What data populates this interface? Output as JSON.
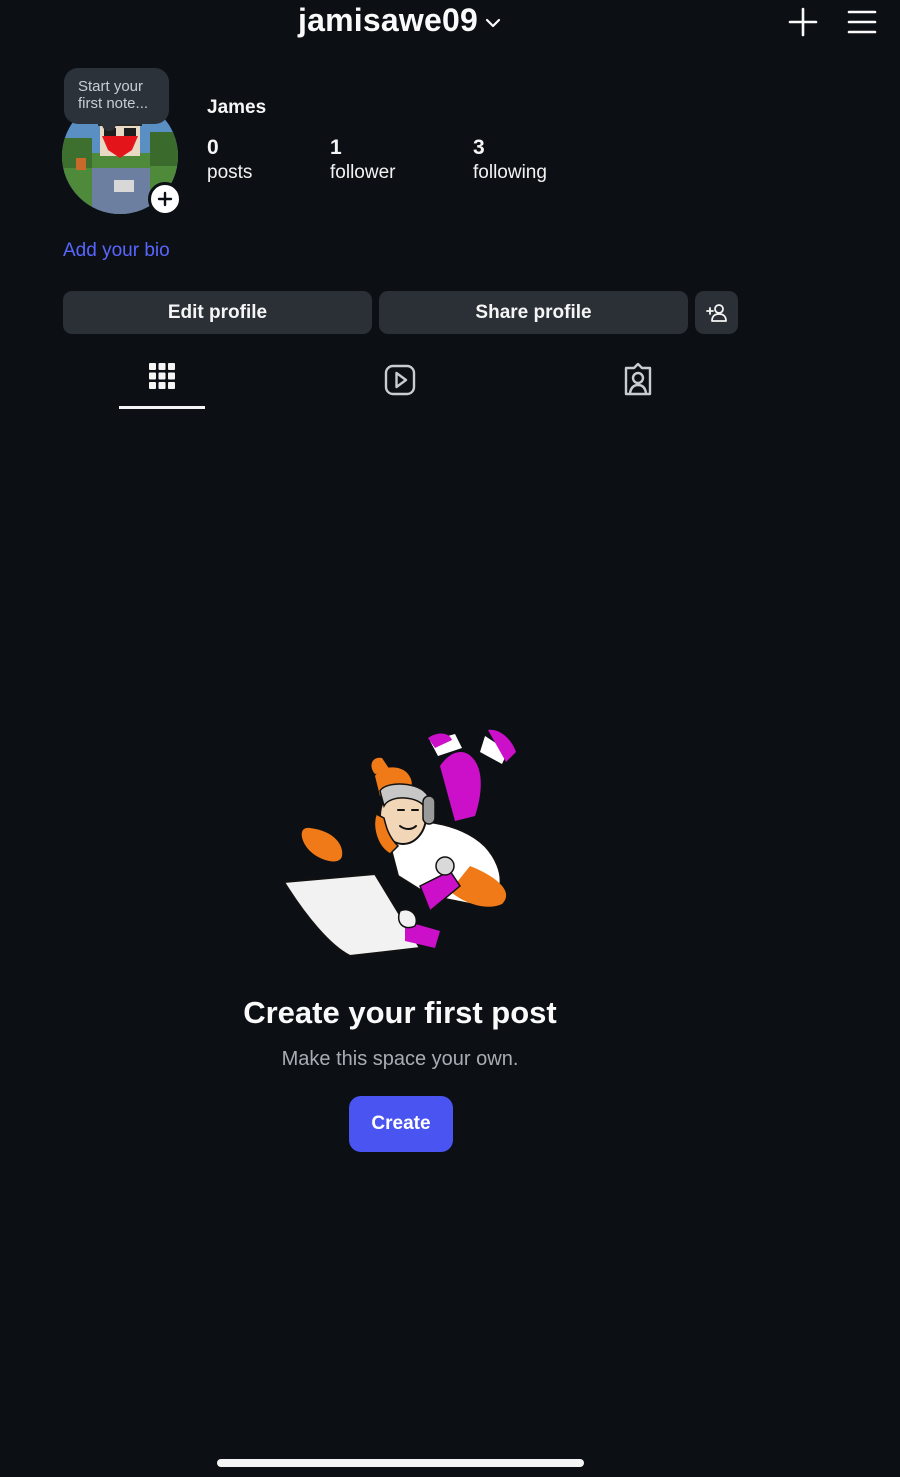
{
  "header": {
    "username": "jamisawe09",
    "icons": [
      "chevron-down-icon",
      "plus-icon",
      "menu-icon"
    ]
  },
  "profile": {
    "note_placeholder": "Start your first note...",
    "display_name": "James",
    "stats": {
      "posts": {
        "count": "0",
        "label": "posts"
      },
      "followers": {
        "count": "1",
        "label": "follower"
      },
      "following": {
        "count": "3",
        "label": "following"
      }
    },
    "bio_link": "Add your bio"
  },
  "actions": {
    "edit_profile": "Edit profile",
    "share_profile": "Share profile",
    "discover_icon": "add-person-icon"
  },
  "tabs": [
    {
      "name": "posts",
      "icon": "grid-icon",
      "active": true
    },
    {
      "name": "reels",
      "icon": "reels-icon",
      "active": false
    },
    {
      "name": "tagged",
      "icon": "tagged-icon",
      "active": false
    }
  ],
  "empty_state": {
    "title": "Create your first post",
    "subtitle": "Make this space your own.",
    "button": "Create"
  },
  "colors": {
    "background": "#0c1015",
    "button_bg": "#2b3036",
    "accent": "#4a54f1",
    "link": "#5865ff"
  }
}
